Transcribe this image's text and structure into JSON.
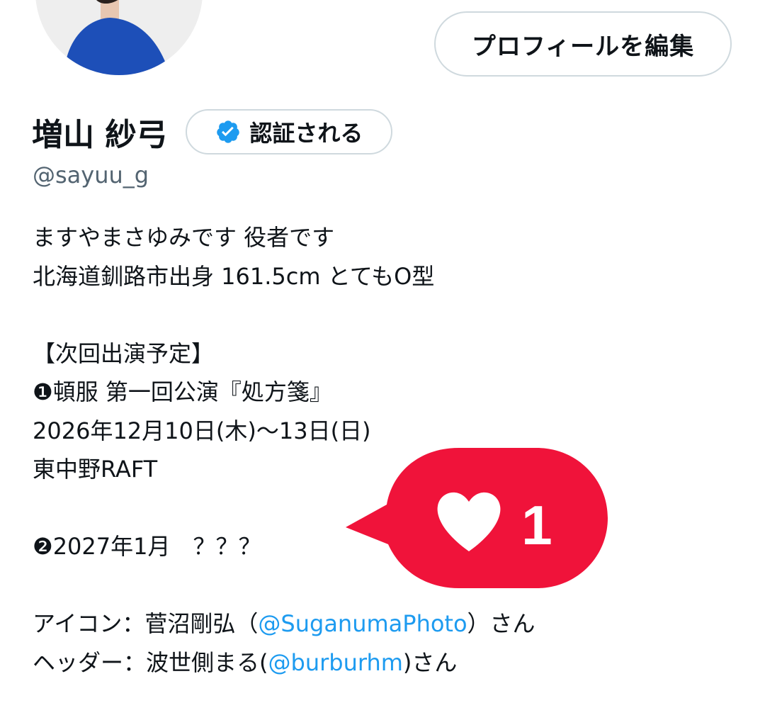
{
  "profile": {
    "edit_button": "プロフィールを編集",
    "display_name": "増山 紗弓",
    "verify_button": "認証される",
    "handle": "@sayuu_g"
  },
  "bio": {
    "line1": "ますやまさゆみです 役者です",
    "line2": "北海道釧路市出身 161.5cm とてもO型",
    "line3": "【次回出演予定】",
    "line4": "❶頓服 第一回公演『処方箋』",
    "line5": "2026年12月10日(木)〜13日(日)",
    "line6": "東中野RAFT",
    "line7": "❷2027年1月　？？？",
    "icon_prefix": "アイコン：菅沼剛弘（",
    "icon_mention": "@SuganumaPhoto",
    "icon_suffix": "）さん",
    "header_prefix": "ヘッダー：波世側まる(",
    "header_mention": "@burburhm",
    "header_suffix": ")さん"
  },
  "notification": {
    "like_count": "1",
    "icon": "heart-icon",
    "color": "#f0133a"
  },
  "colors": {
    "link": "#1d9bf0",
    "verified_badge": "#1d9bf0"
  }
}
